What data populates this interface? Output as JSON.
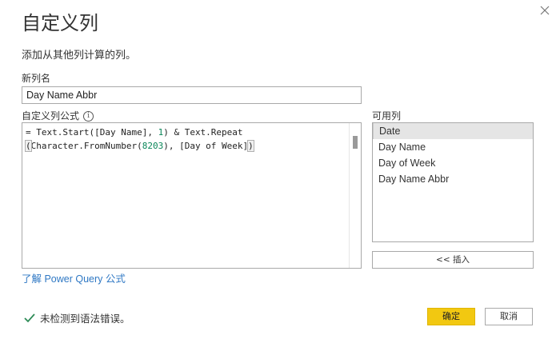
{
  "dialog": {
    "title": "自定义列",
    "subtitle": "添加从其他列计算的列。",
    "close_icon": "close-icon"
  },
  "name_field": {
    "label": "新列名",
    "value": "Day Name Abbr"
  },
  "formula_field": {
    "label": "自定义列公式",
    "info_icon": "info-icon",
    "line1": {
      "a": "= Text.Start([Day Name], ",
      "num": "1",
      "b": ") & Text.Repeat"
    },
    "line2": {
      "open": "(",
      "a": "Character.FromNumber(",
      "num": "8203",
      "b": "), [Day of Week]",
      "close": ")"
    }
  },
  "available_columns": {
    "label": "可用列",
    "items": [
      {
        "label": "Date",
        "selected": true
      },
      {
        "label": "Day Name",
        "selected": false
      },
      {
        "label": "Day of Week",
        "selected": false
      },
      {
        "label": "Day Name Abbr",
        "selected": false
      }
    ],
    "insert_label": "<< 插入"
  },
  "learn_link": "了解 Power Query 公式",
  "status": {
    "icon": "check-icon",
    "text": "未检测到语法错误。",
    "color": "#2e8b57"
  },
  "buttons": {
    "ok": "确定",
    "cancel": "取消"
  },
  "colors": {
    "accent": "#f2c811",
    "link": "#2f78c4",
    "number": "#098658"
  }
}
